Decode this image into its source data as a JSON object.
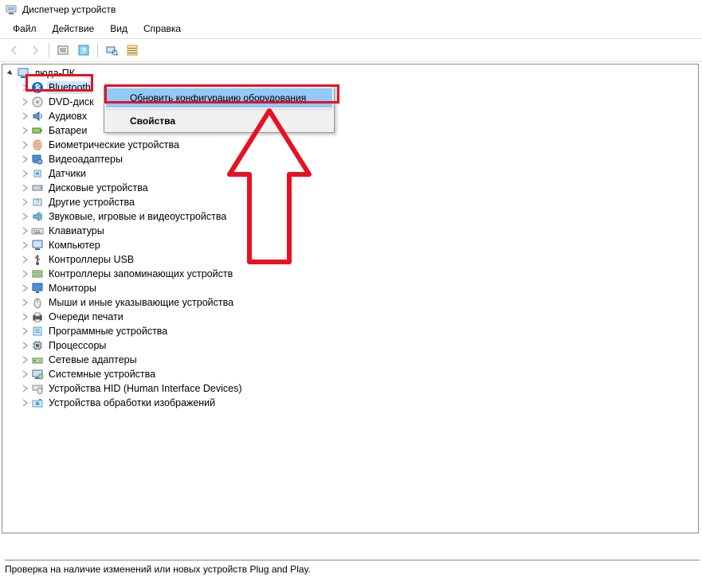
{
  "window": {
    "title": "Диспетчер устройств"
  },
  "menu": {
    "file": "Файл",
    "action": "Действие",
    "view": "Вид",
    "help": "Справка"
  },
  "tree": {
    "root": "люда-ПК",
    "items": [
      "Bluetooth",
      "DVD-диск",
      "Аудиовх",
      "Батареи",
      "Биометрические устройства",
      "Видеоадаптеры",
      "Датчики",
      "Дисковые устройства",
      "Другие устройства",
      "Звуковые, игровые и видеоустройства",
      "Клавиатуры",
      "Компьютер",
      "Контроллеры USB",
      "Контроллеры запоминающих устройств",
      "Мониторы",
      "Мыши и иные указывающие устройства",
      "Очереди печати",
      "Программные устройства",
      "Процессоры",
      "Сетевые адаптеры",
      "Системные устройства",
      "Устройства HID (Human Interface Devices)",
      "Устройства обработки изображений"
    ]
  },
  "context_menu": {
    "scan": "Обновить конфигурацию оборудования",
    "properties": "Свойства"
  },
  "status": {
    "text": "Проверка на наличие изменений или новых устройств Plug and Play."
  },
  "colors": {
    "highlight_red": "#e81123",
    "selection_blue": "#cce8ff",
    "menu_hover": "#91c9f7"
  }
}
